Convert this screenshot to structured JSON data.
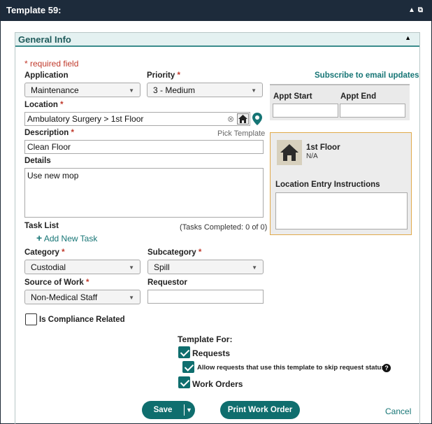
{
  "window": {
    "title": "Template 59:"
  },
  "panel": {
    "title": "General Info"
  },
  "form": {
    "required_note": "* required field",
    "application": {
      "label": "Application",
      "value": "Maintenance"
    },
    "priority": {
      "label": "Priority",
      "value": "3 - Medium"
    },
    "location": {
      "label": "Location",
      "value": "Ambulatory Surgery > 1st Floor"
    },
    "description": {
      "label": "Description",
      "value": "Clean Floor"
    },
    "pick_template": "Pick Template",
    "details": {
      "label": "Details",
      "value": "Use new mop"
    },
    "task_list": {
      "label": "Task List",
      "completed": "(Tasks Completed: 0 of 0)",
      "add_label": "Add New Task"
    },
    "category": {
      "label": "Category",
      "value": "Custodial"
    },
    "subcategory": {
      "label": "Subcategory",
      "value": "Spill"
    },
    "source_of_work": {
      "label": "Source of Work",
      "value": "Non-Medical Staff"
    },
    "requestor": {
      "label": "Requestor",
      "value": ""
    },
    "compliance": {
      "label": "Is Compliance Related",
      "checked": false
    }
  },
  "subscribe": "Subscribe to email updates",
  "appt": {
    "start_label": "Appt Start",
    "end_label": "Appt End",
    "start_value": "",
    "end_value": ""
  },
  "location_info": {
    "name": "1st Floor",
    "sub": "N/A",
    "instructions_label": "Location Entry Instructions",
    "instructions_value": ""
  },
  "template_for": {
    "label": "Template For:",
    "requests": "Requests",
    "skip_status": "Allow requests that use this template to skip request status.",
    "work_orders": "Work Orders"
  },
  "actions": {
    "save": "Save",
    "print": "Print Work Order",
    "cancel": "Cancel"
  },
  "colors": {
    "accent": "#0f6e6e",
    "titlebar": "#1d2b3b",
    "required": "#c0392b",
    "location_border": "#e0a94a"
  }
}
